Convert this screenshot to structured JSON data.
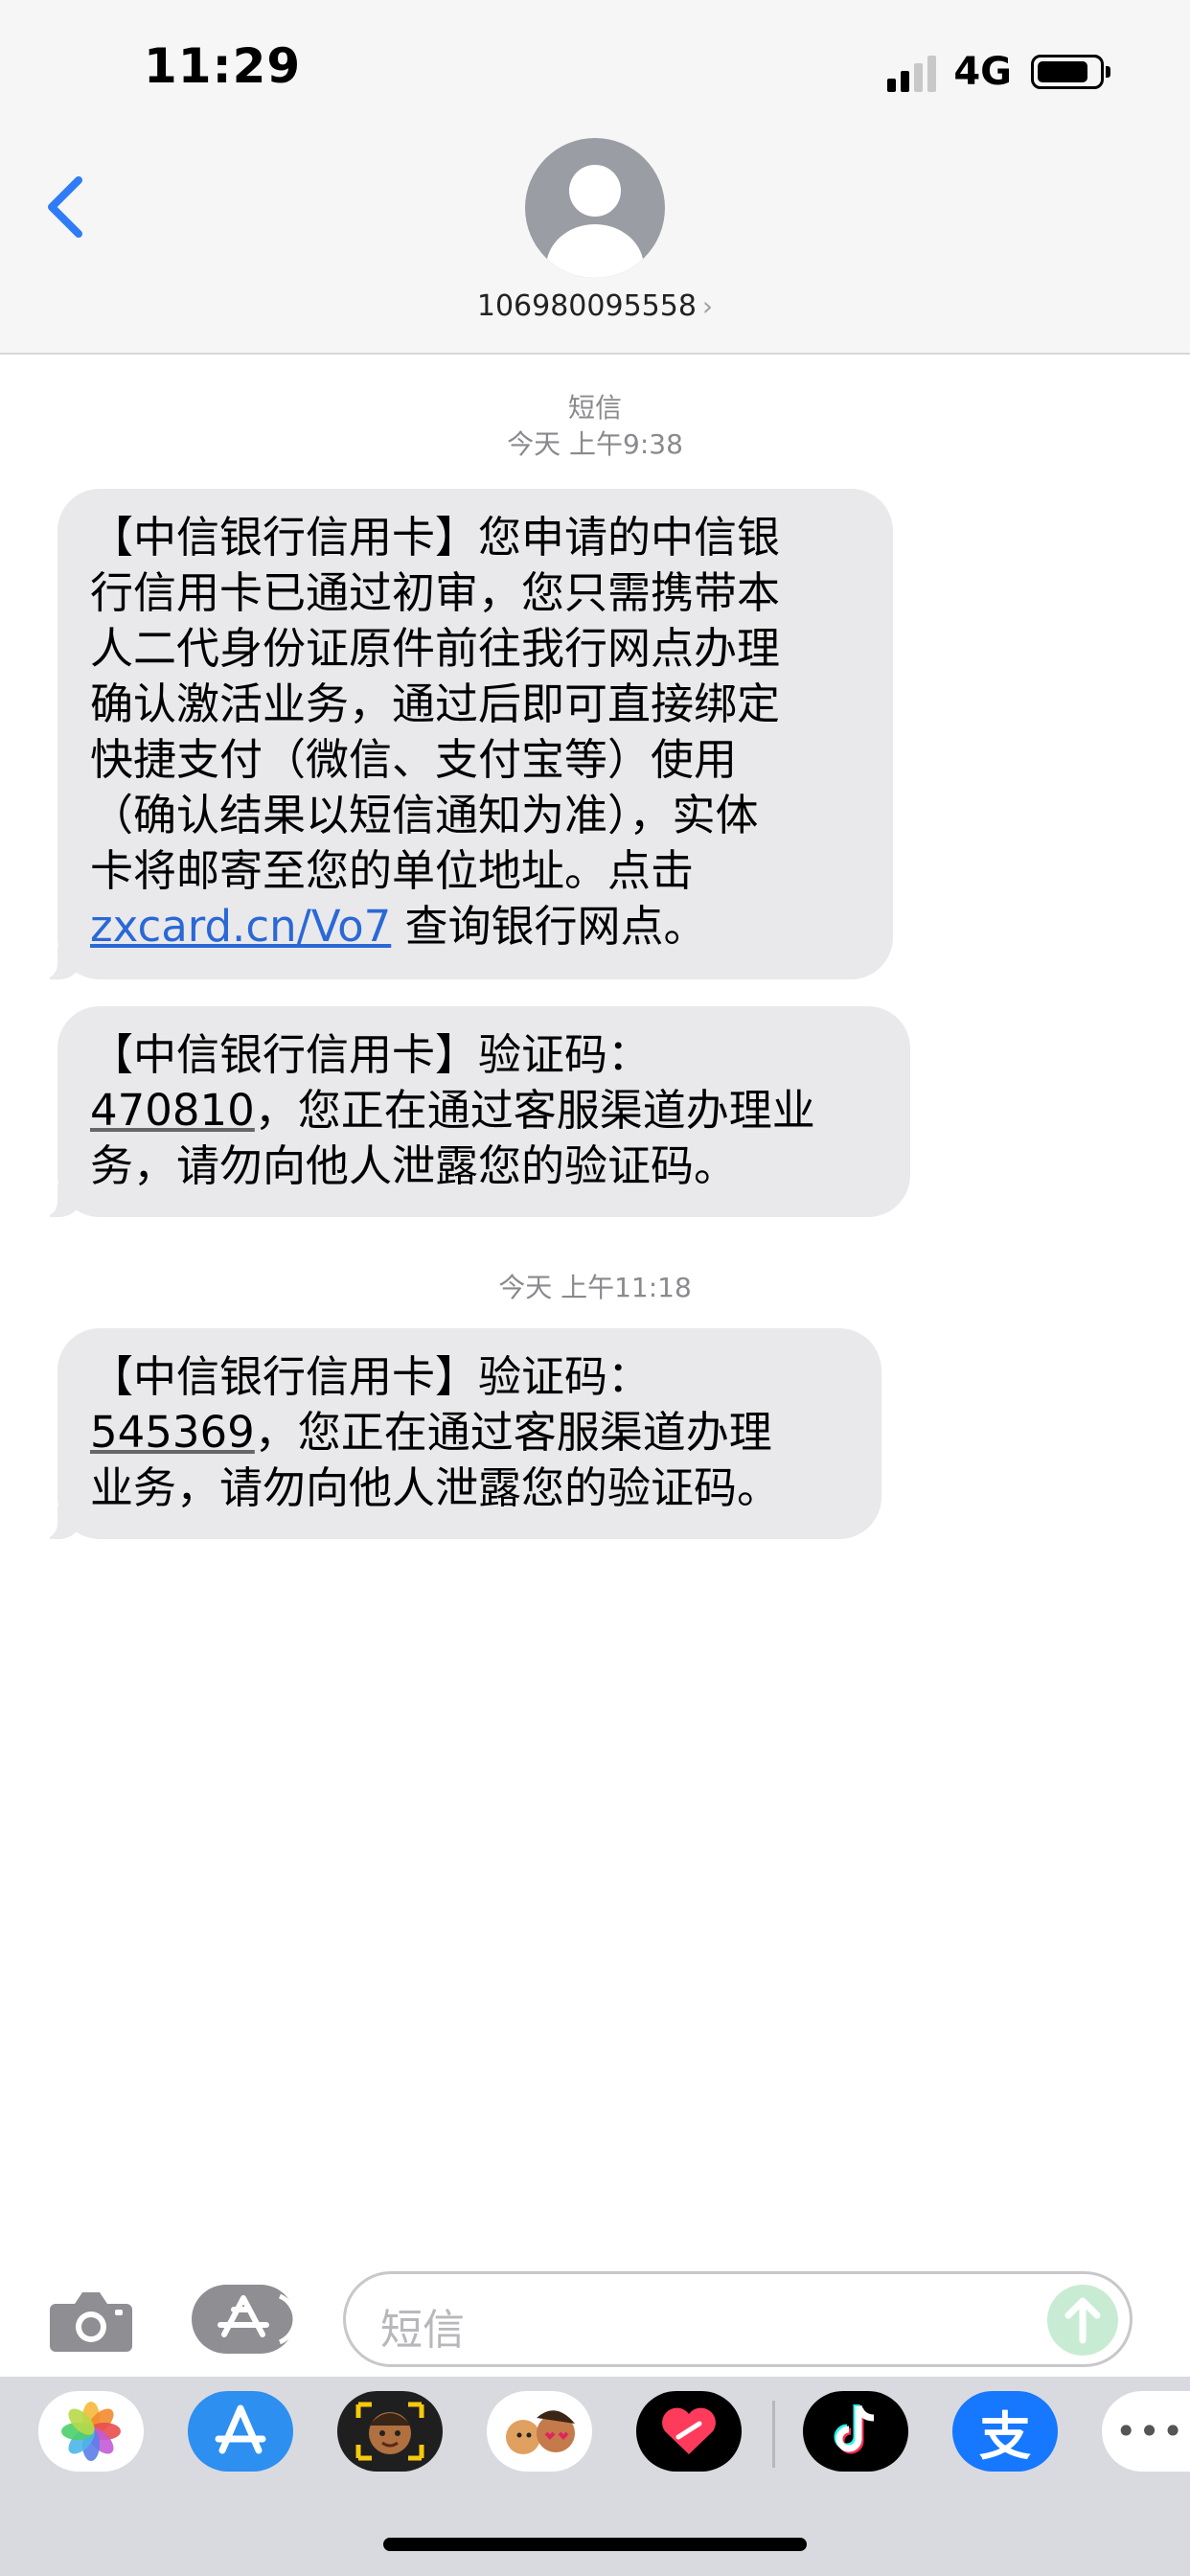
{
  "status_bar": {
    "time": "11:29",
    "network": "4G"
  },
  "header": {
    "contact_number": "106980095558",
    "chevron": "›",
    "back_icon": "chevron-left-icon",
    "avatar_icon": "person-icon"
  },
  "messages": {
    "thread_label": "短信",
    "timestamp_1": "今天 上午9:38",
    "timestamp_2": "今天 上午11:18",
    "msg1": {
      "line1": "【中信银行信用卡】您申请的中信银",
      "line2": "行信用卡已通过初审，您只需携带本",
      "line3": "人二代身份证原件前往我行网点办理",
      "line4": "确认激活业务，通过后即可直接绑定",
      "line5": "快捷支付（微信、支付宝等）使用",
      "line6": "（确认结果以短信通知为准），实体",
      "line7": "卡将邮寄至您的单位地址。点击",
      "link": "zxcard.cn/Vo7",
      "line8_rest": " 查询银行网点。"
    },
    "msg2": {
      "line1": "【中信银行信用卡】验证码：",
      "code": "470810",
      "line2_rest": "，您正在通过客服渠道办理业",
      "line3": "务，请勿向他人泄露您的验证码。"
    },
    "msg3": {
      "line1": "【中信银行信用卡】验证码：",
      "code": "545369",
      "line2_rest": "，您正在通过客服渠道办理",
      "line3": "业务，请勿向他人泄露您的验证码。"
    }
  },
  "compose": {
    "placeholder": "短信"
  },
  "app_drawer": {
    "apps": [
      "photos-app-icon",
      "app-store-icon",
      "memoji-icon",
      "animoji-icon",
      "digital-touch-icon",
      "tiktok-icon",
      "alipay-icon",
      "more-icon"
    ],
    "alipay_glyph": "支",
    "more_glyph": "•••"
  },
  "colors": {
    "link": "#2a68d6",
    "bubble": "#e9e9eb",
    "back": "#2f7cf6"
  }
}
